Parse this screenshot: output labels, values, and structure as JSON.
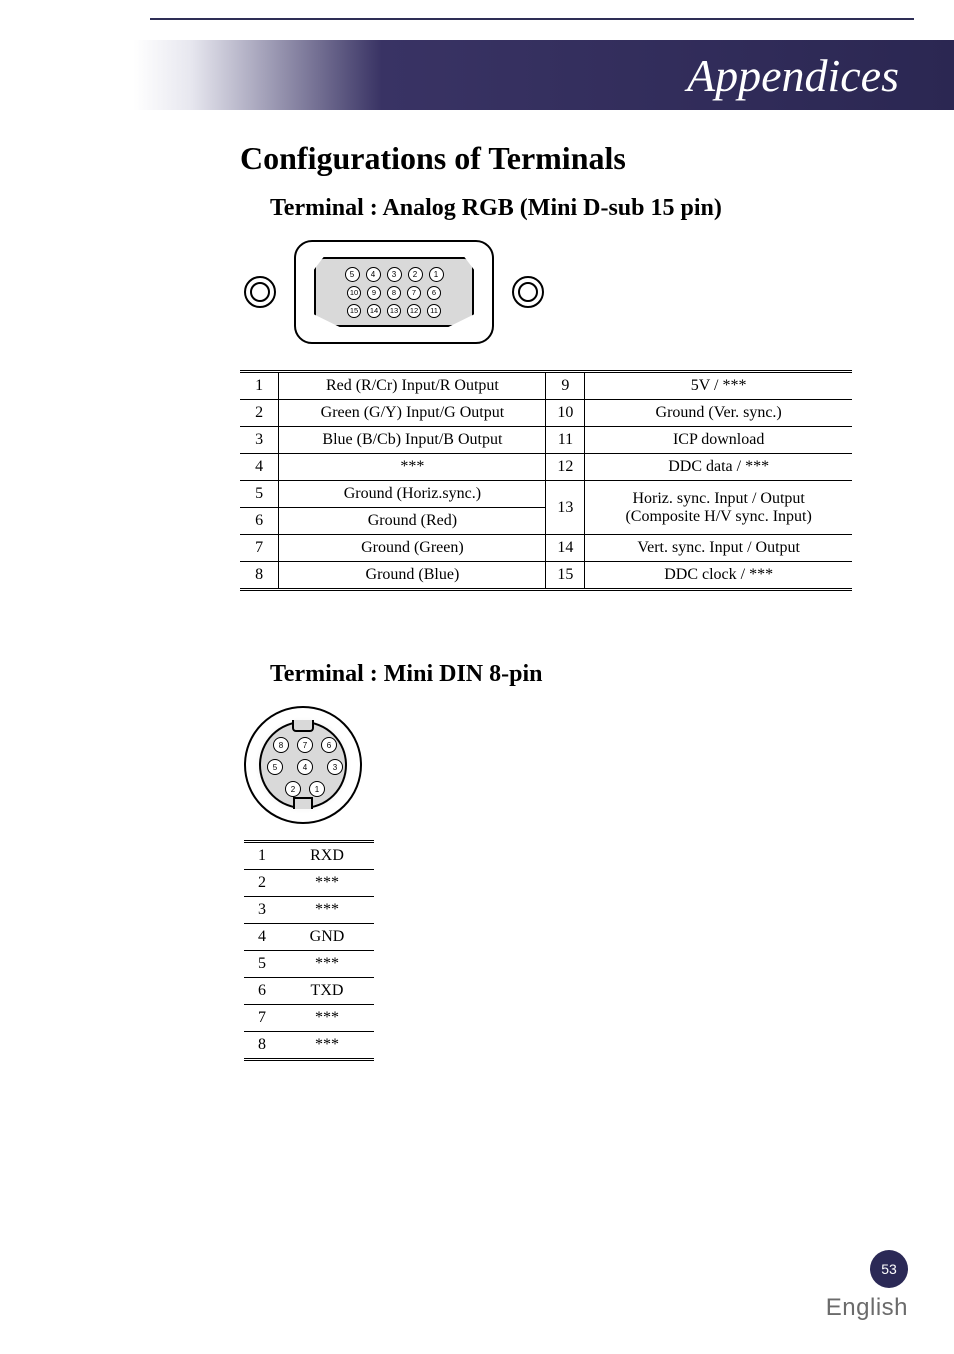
{
  "banner": {
    "title": "Appendices"
  },
  "section_title": "Configurations of Terminals",
  "terminal1": {
    "heading": "Terminal : Analog RGB (Mini D-sub 15 pin)",
    "pin_rows": [
      [
        "5",
        "4",
        "3",
        "2",
        "1"
      ],
      [
        "10",
        "9",
        "8",
        "7",
        "6"
      ],
      [
        "15",
        "14",
        "13",
        "12",
        "11"
      ]
    ],
    "table_left": [
      {
        "n": "1",
        "d": "Red (R/Cr) Input/R Output"
      },
      {
        "n": "2",
        "d": "Green (G/Y) Input/G Output"
      },
      {
        "n": "3",
        "d": "Blue (B/Cb) Input/B Output"
      },
      {
        "n": "4",
        "d": "***"
      },
      {
        "n": "5",
        "d": "Ground (Horiz.sync.)"
      },
      {
        "n": "6",
        "d": "Ground (Red)"
      },
      {
        "n": "7",
        "d": "Ground (Green)"
      },
      {
        "n": "8",
        "d": "Ground (Blue)"
      }
    ],
    "table_right": [
      {
        "n": "9",
        "d": "5V / ***"
      },
      {
        "n": "10",
        "d": "Ground (Ver. sync.)"
      },
      {
        "n": "11",
        "d": "ICP download"
      },
      {
        "n": "12",
        "d": "DDC data / ***"
      },
      {
        "n": "13",
        "d": "Horiz. sync. Input / Output (Composite H/V sync. Input)"
      },
      {
        "n": "14",
        "d": "Vert. sync. Input / Output"
      },
      {
        "n": "15",
        "d": "DDC clock / ***"
      }
    ]
  },
  "terminal2": {
    "heading": "Terminal : Mini DIN 8-pin",
    "pins": [
      "8",
      "7",
      "6",
      "5",
      "4",
      "3",
      "2",
      "1"
    ],
    "table": [
      {
        "n": "1",
        "d": "RXD"
      },
      {
        "n": "2",
        "d": "***"
      },
      {
        "n": "3",
        "d": "***"
      },
      {
        "n": "4",
        "d": "GND"
      },
      {
        "n": "5",
        "d": "***"
      },
      {
        "n": "6",
        "d": "TXD"
      },
      {
        "n": "7",
        "d": "***"
      },
      {
        "n": "8",
        "d": "***"
      }
    ]
  },
  "footer": {
    "page": "53",
    "lang": "English"
  }
}
